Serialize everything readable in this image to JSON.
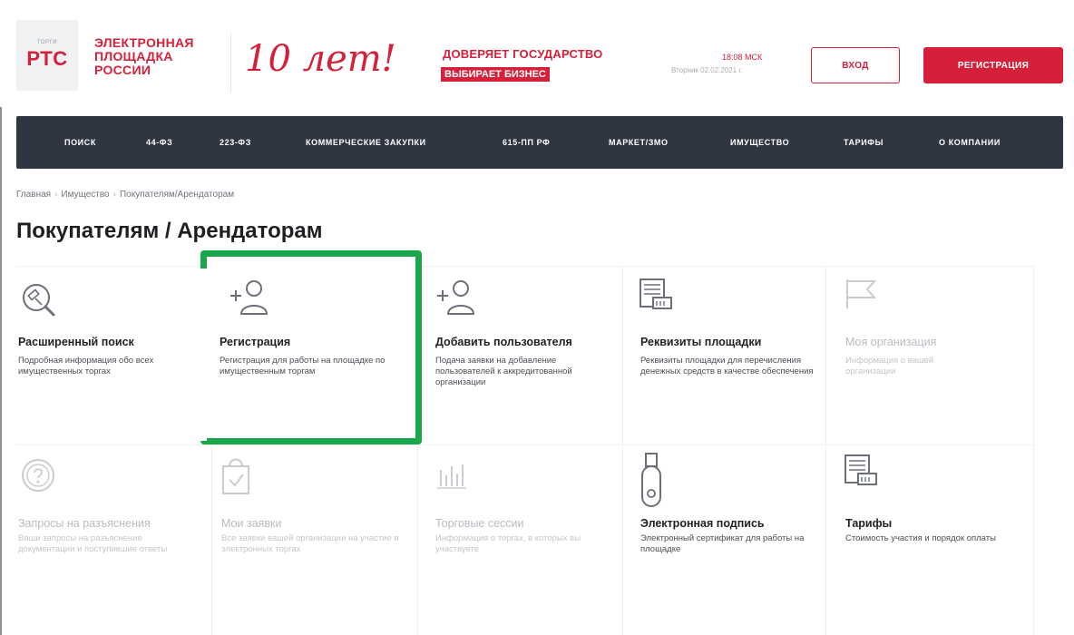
{
  "header": {
    "logo_small": "ТОРГИ",
    "logo_main": "РТС",
    "logo_text": [
      "ЭЛЕКТРОННАЯ",
      "ПЛОЩАДКА",
      "РОССИИ"
    ],
    "anniversary": "10 лет!",
    "slogan_line1": "ДОВЕРЯЕТ ГОСУДАРСТВО",
    "slogan_line2": "ВЫБИРАЕТ БИЗНЕС",
    "time": "18:08 МСК",
    "date": "Вторник 02.02.2021 г.",
    "login_label": "ВХОД",
    "register_label": "РЕГИСТРАЦИЯ"
  },
  "nav": {
    "items": [
      "ПОИСК",
      "44-ФЗ",
      "223-ФЗ",
      "КОММЕРЧЕСКИЕ ЗАКУПКИ",
      "615-ПП РФ",
      "МАРКЕТ/ЗМО",
      "ИМУЩЕСТВО",
      "ТАРИФЫ",
      "О КОМПАНИИ"
    ]
  },
  "breadcrumb": [
    "Главная",
    "Имущество",
    "Покупателям/Арендаторам"
  ],
  "page_title": "Покупателям / Арендаторам",
  "cards": [
    {
      "title": "Расширенный поиск",
      "desc": "Подробная информация обо всех имущественных торгах",
      "icon": "search-hammer-icon"
    },
    {
      "title": "Регистрация",
      "desc": "Регистрация для работы на площадке по имущественным торгам",
      "icon": "add-user-icon"
    },
    {
      "title": "Добавить пользователя",
      "desc": "Подача заявки на добавление пользователей к аккредитованной организации",
      "icon": "add-user-icon"
    },
    {
      "title": "Реквизиты площадки",
      "desc": "Реквизиты площадки для перечисления денежных средств в качестве обеспечения",
      "icon": "document-card-icon"
    },
    {
      "title": "Моя организация",
      "desc": "Информация о вашей организации",
      "icon": "flag-icon"
    },
    {
      "title": "Запросы на разъяснения",
      "desc": "Ваши запросы на разъяснение документации и поступившие ответы",
      "icon": "question-icon"
    },
    {
      "title": "Мои заявки",
      "desc": "Все заявки вашей организации на участие в электронных торгах",
      "icon": "shopping-bag-check-icon"
    },
    {
      "title": "Торговые сессии",
      "desc": "Информация о торгах, в которых вы участвуете",
      "icon": "bar-chart-icon"
    },
    {
      "title": "Электронная подпись",
      "desc": "Электронный сертификат для работы на площадке",
      "icon": "usb-token-icon"
    },
    {
      "title": "Тарифы",
      "desc": "Стоимость участия и порядок оплаты",
      "icon": "document-card-icon"
    }
  ],
  "colors": {
    "brand_red": "#d6203a",
    "nav_bg": "#2f3541",
    "highlight_green": "#1aa64a"
  }
}
